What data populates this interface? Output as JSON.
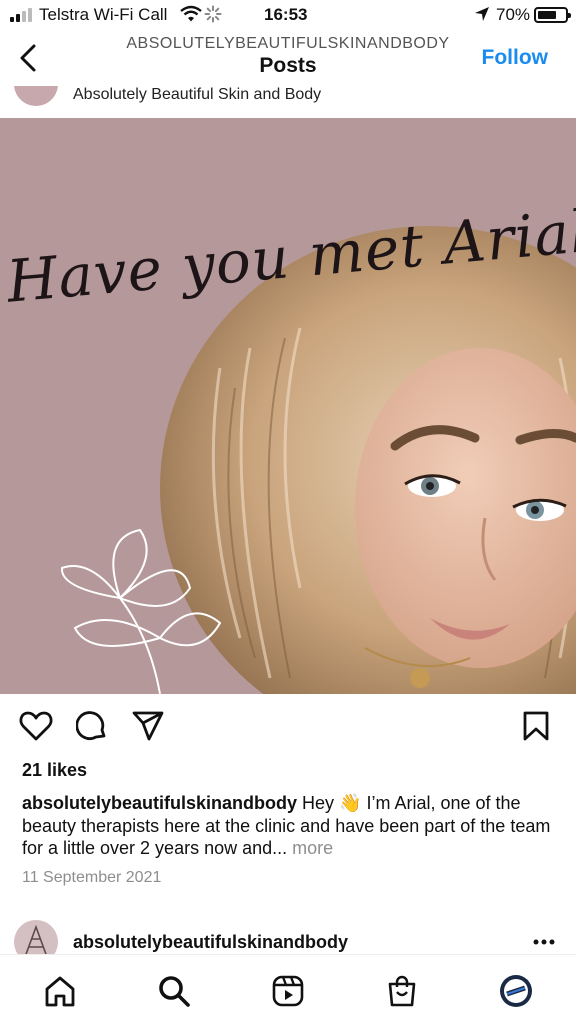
{
  "status_bar": {
    "carrier": "Telstra Wi-Fi Call",
    "time": "16:53",
    "battery_percent": "70%",
    "battery_level": 0.7,
    "icons": [
      "signal-icon",
      "wifi-icon",
      "loading-icon",
      "location-icon",
      "battery-icon"
    ]
  },
  "header": {
    "username": "ABSOLUTELYBEAUTIFULSKINANDBODY",
    "title": "Posts",
    "follow_label": "Follow",
    "accent_color": "#1a8cf0"
  },
  "previous_post": {
    "account_name": "Absolutely Beautiful Skin and Body"
  },
  "post": {
    "image_text": "Have you met Arial?",
    "image_background": "#b59899",
    "likes": "21 likes",
    "caption_user": "absolutelybeautifulskinandbody",
    "caption_text": " Hey 👋 I’m Arial, one of the beauty therapists here at the clinic and have been part of the team for a little over 2 years now and...",
    "caption_more": " more",
    "date": "11 September 2021",
    "action_icons": [
      "heart-icon",
      "comment-icon",
      "share-icon",
      "bookmark-icon"
    ]
  },
  "next_post": {
    "account_name": "absolutelybeautifulskinandbody"
  },
  "bottom_nav": {
    "items": [
      "home-icon",
      "search-icon",
      "reels-icon",
      "shop-icon",
      "profile-avatar"
    ]
  }
}
